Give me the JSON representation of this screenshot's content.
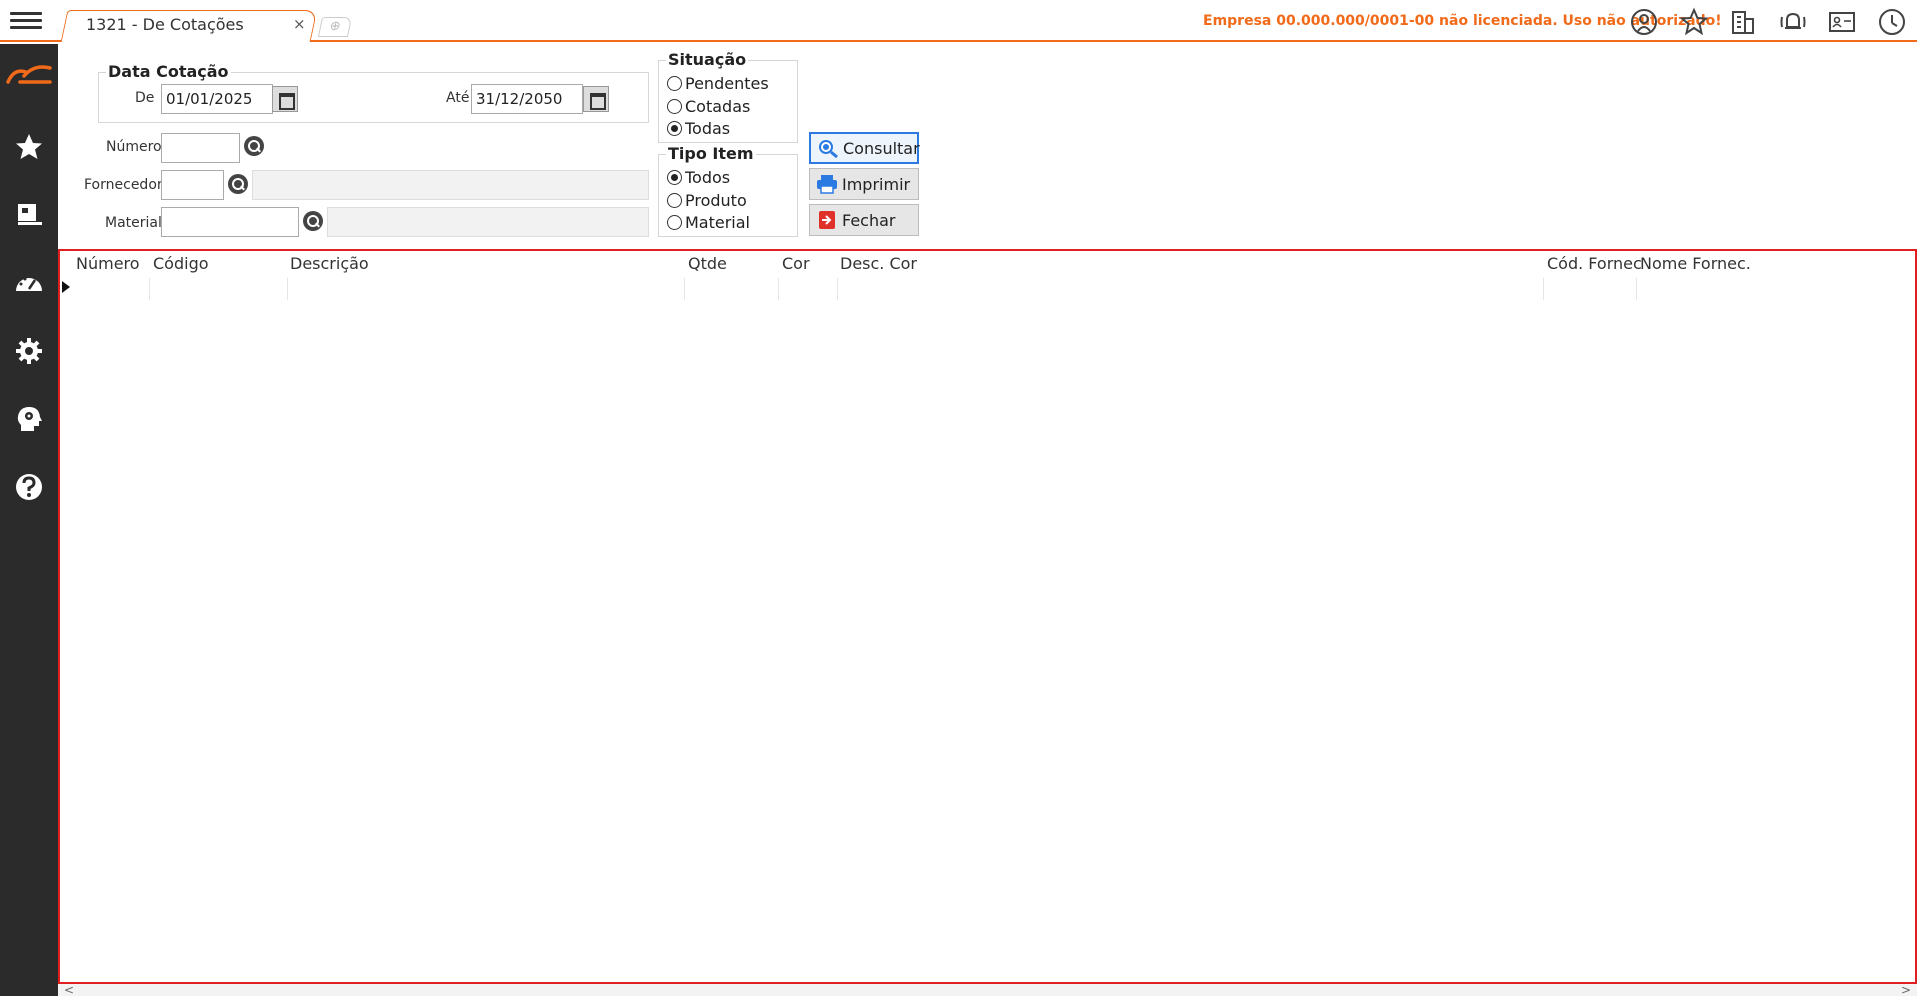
{
  "topbar": {
    "tab_label": "1321 - De Cotações",
    "tab_close": "×",
    "tab_add": "⊕",
    "license_message": "Empresa 00.000.000/0001-00 não licenciada. Uso não autorizado!",
    "accent_color": "#f06a1a"
  },
  "sidebar": {
    "background": "#2b2b2b",
    "icons": [
      "logo-icon",
      "star-icon",
      "document-icon",
      "speedometer-icon",
      "gear-icon",
      "head-gear-icon",
      "help-icon"
    ]
  },
  "filters": {
    "date_group_title": "Data Cotação",
    "from_label": "De",
    "from_value": "01/01/2025",
    "to_label": "Até",
    "to_value": "31/12/2050",
    "number_label": "Número",
    "number_value": "",
    "supplier_label": "Fornecedor",
    "supplier_value": "",
    "supplier_name": "",
    "material_label": "Material",
    "material_value": "",
    "material_name": ""
  },
  "situacao": {
    "title": "Situação",
    "options": [
      "Pendentes",
      "Cotadas",
      "Todas"
    ],
    "selected": "Todas"
  },
  "tipo_item": {
    "title": "Tipo Item",
    "options": [
      "Todos",
      "Produto",
      "Material"
    ],
    "selected": "Todos"
  },
  "actions": {
    "consultar": "Consultar",
    "imprimir": "Imprimir",
    "fechar": "Fechar"
  },
  "grid": {
    "columns": [
      "Número",
      "Código",
      "Descrição",
      "Qtde",
      "Cor",
      "Desc. Cor",
      "Cód. Fornec",
      "Nome Fornec."
    ],
    "rows": []
  }
}
